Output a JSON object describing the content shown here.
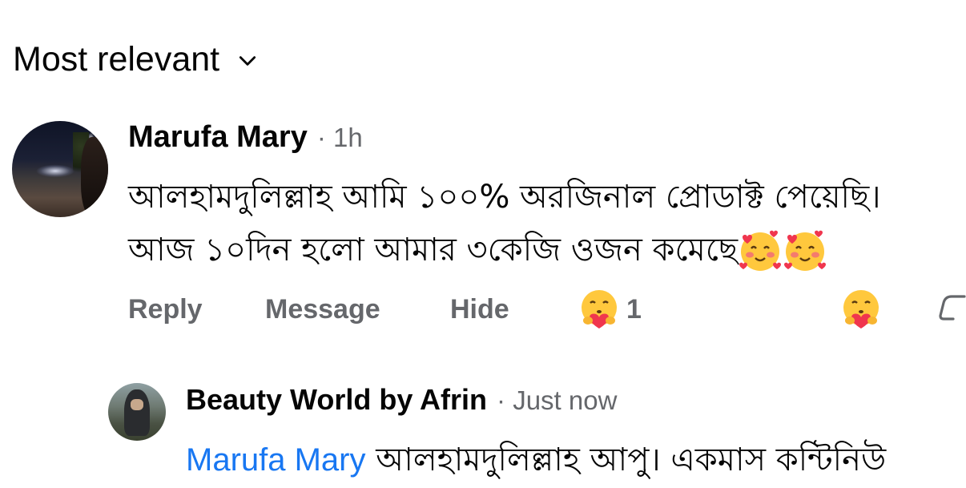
{
  "sort": {
    "label": "Most relevant"
  },
  "comment": {
    "author": "Marufa Mary",
    "time": "· 1h",
    "line1": "আলহামদুলিল্লাহ আমি ১০০% অরজিনাল প্রোডাক্ট পেয়েছি।",
    "line2": "আজ ১০দিন হলো আমার ৩কেজি ওজন কমেছে",
    "actions": {
      "reply": "Reply",
      "message": "Message",
      "hide": "Hide"
    },
    "reaction_count": "1"
  },
  "reply": {
    "author": "Beauty World by Afrin",
    "time": "· Just now",
    "mention": "Marufa Mary",
    "text": "আলহামদুলিল্লাহ আপু। একমাস কন্টিনিউ"
  }
}
